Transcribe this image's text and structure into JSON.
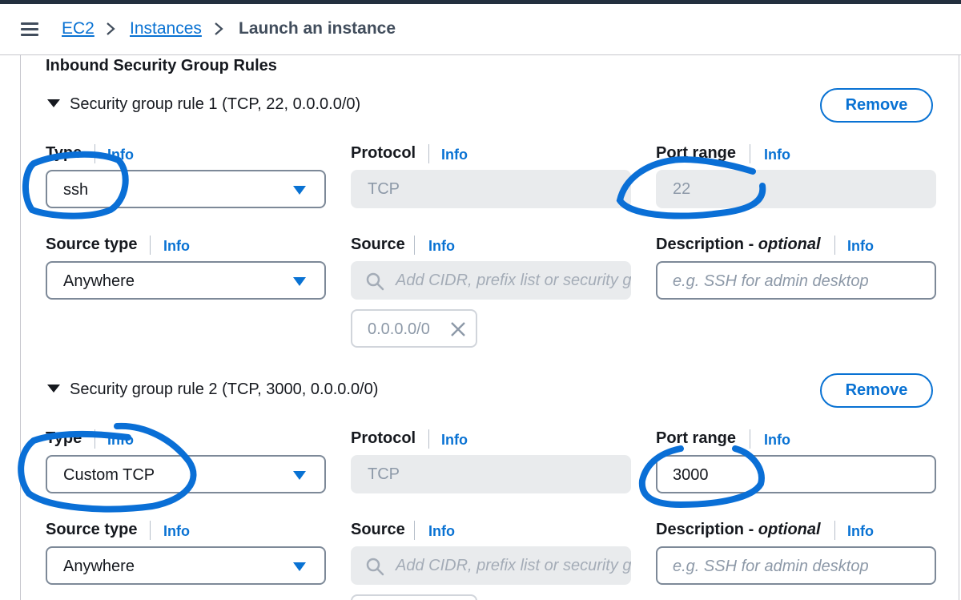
{
  "breadcrumb": {
    "items": [
      {
        "label": "EC2"
      },
      {
        "label": "Instances"
      }
    ],
    "current": "Launch an instance"
  },
  "section": {
    "title": "Inbound Security Group Rules"
  },
  "rules": [
    {
      "header": "Security group rule 1 (TCP, 22, 0.0.0.0/0)",
      "remove_label": "Remove",
      "type": {
        "label": "Type",
        "info": "Info",
        "value": "ssh"
      },
      "protocol": {
        "label": "Protocol",
        "info": "Info",
        "value": "TCP"
      },
      "port_range": {
        "label": "Port range",
        "info": "Info",
        "value": "22"
      },
      "source_type": {
        "label": "Source type",
        "info": "Info",
        "value": "Anywhere"
      },
      "source": {
        "label": "Source",
        "info": "Info",
        "placeholder": "Add CIDR, prefix list or security group",
        "token": "0.0.0.0/0"
      },
      "description": {
        "label": "Description - ",
        "label_em": "optional",
        "info": "Info",
        "placeholder": "e.g. SSH for admin desktop"
      }
    },
    {
      "header": "Security group rule 2 (TCP, 3000, 0.0.0.0/0)",
      "remove_label": "Remove",
      "type": {
        "label": "Type",
        "info": "Info",
        "value": "Custom TCP"
      },
      "protocol": {
        "label": "Protocol",
        "info": "Info",
        "value": "TCP"
      },
      "port_range": {
        "label": "Port range",
        "info": "Info",
        "value": "3000"
      },
      "source_type": {
        "label": "Source type",
        "info": "Info",
        "value": "Anywhere"
      },
      "source": {
        "label": "Source",
        "info": "Info",
        "placeholder": "Add CIDR, prefix list or security group"
      },
      "description": {
        "label": "Description - ",
        "label_em": "optional",
        "info": "Info",
        "placeholder": "e.g. SSH for admin desktop"
      }
    }
  ],
  "colors": {
    "link": "#0972d3",
    "annotation": "#0a6fd6",
    "top_bar": "#232f3e"
  },
  "icons": [
    "menu-icon",
    "chevron-right-icon",
    "caret-down-icon",
    "search-icon",
    "close-icon",
    "expand-triangle-icon"
  ]
}
